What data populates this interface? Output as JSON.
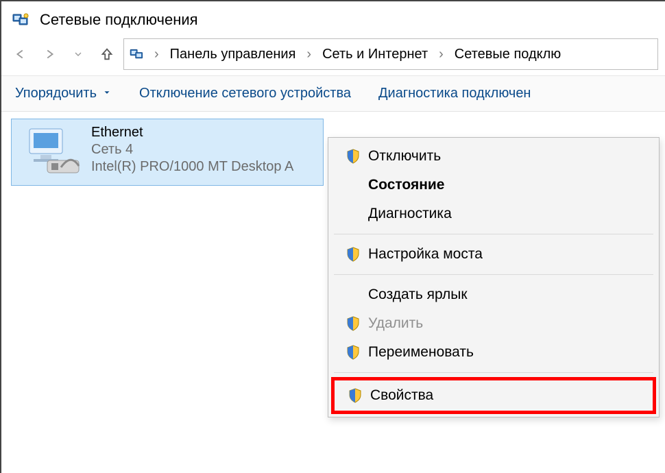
{
  "window": {
    "title": "Сетевые подключения"
  },
  "breadcrumb": {
    "items": [
      "Панель управления",
      "Сеть и Интернет",
      "Сетевые подклю"
    ]
  },
  "toolbar": {
    "organize_label": "Упорядочить",
    "disable_device_label": "Отключение сетевого устройства",
    "diagnose_label": "Диагностика подключен"
  },
  "connection": {
    "name": "Ethernet",
    "network": "Сеть 4",
    "device": "Intel(R) PRO/1000 MT Desktop A"
  },
  "context_menu": {
    "disable": "Отключить",
    "status": "Состояние",
    "diagnostics": "Диагностика",
    "bridge": "Настройка моста",
    "shortcut": "Создать ярлык",
    "delete": "Удалить",
    "rename": "Переименовать",
    "properties": "Свойства"
  }
}
